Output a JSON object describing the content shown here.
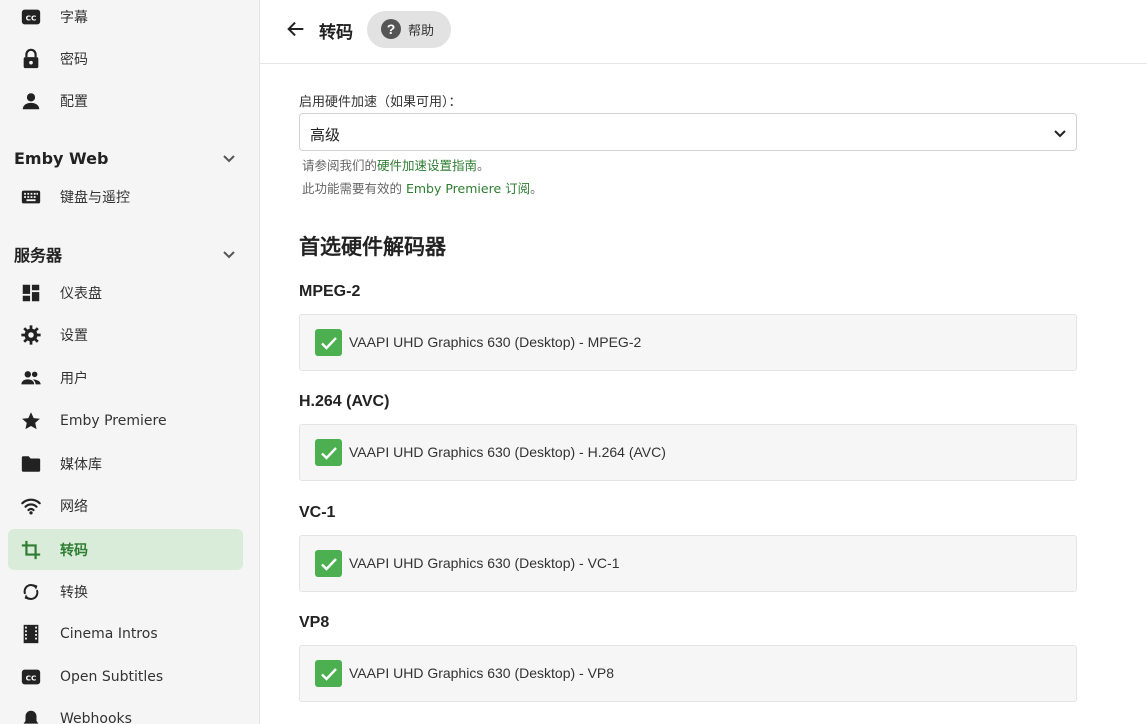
{
  "sidebar": {
    "items_top": [
      {
        "label": "字幕",
        "icon": "cc-icon"
      },
      {
        "label": "密码",
        "icon": "lock-icon"
      },
      {
        "label": "配置",
        "icon": "person-icon"
      }
    ],
    "sections": [
      {
        "title": "Emby Web",
        "items": [
          {
            "label": "键盘与遥控",
            "icon": "keyboard-icon"
          }
        ]
      },
      {
        "title": "服务器",
        "items": [
          {
            "label": "仪表盘",
            "icon": "dashboard-icon"
          },
          {
            "label": "设置",
            "icon": "gear-icon"
          },
          {
            "label": "用户",
            "icon": "people-icon"
          },
          {
            "label": "Emby Premiere",
            "icon": "star-icon"
          },
          {
            "label": "媒体库",
            "icon": "folder-icon"
          },
          {
            "label": "网络",
            "icon": "wifi-icon"
          },
          {
            "label": "转码",
            "icon": "crop-icon"
          },
          {
            "label": "转换",
            "icon": "sync-icon"
          },
          {
            "label": "Cinema Intros",
            "icon": "film-icon"
          },
          {
            "label": "Open Subtitles",
            "icon": "cc-icon"
          },
          {
            "label": "Webhooks",
            "icon": "bell-icon"
          }
        ]
      }
    ],
    "active_item": "转码"
  },
  "header": {
    "title": "转码",
    "help_label": "帮助",
    "help_icon": "question-circle-icon",
    "back_icon": "arrow-left-icon"
  },
  "hw_accel": {
    "label": "启用硬件加速（如果可用）：",
    "value": "高级",
    "help1_prefix": "请参阅我们的",
    "help1_link": "硬件加速设置指南",
    "help1_suffix": "。",
    "help2_prefix": "此功能需要有效的 ",
    "help2_link": "Emby Premiere 订阅",
    "help2_suffix": "。"
  },
  "decoders": {
    "title": "首选硬件解码器",
    "groups": [
      {
        "title": "MPEG-2",
        "option": "VAAPI UHD Graphics 630 (Desktop) - MPEG-2",
        "checked": true
      },
      {
        "title": "H.264 (AVC)",
        "option": "VAAPI UHD Graphics 630 (Desktop) - H.264 (AVC)",
        "checked": true
      },
      {
        "title": "VC-1",
        "option": "VAAPI UHD Graphics 630 (Desktop) - VC-1",
        "checked": true
      },
      {
        "title": "VP8",
        "option": "VAAPI UHD Graphics 630 (Desktop) - VP8",
        "checked": true
      }
    ]
  },
  "colors": {
    "accent": "#2e7d32",
    "active_bg": "#d9ecd9",
    "check_bg": "#4caf50"
  }
}
